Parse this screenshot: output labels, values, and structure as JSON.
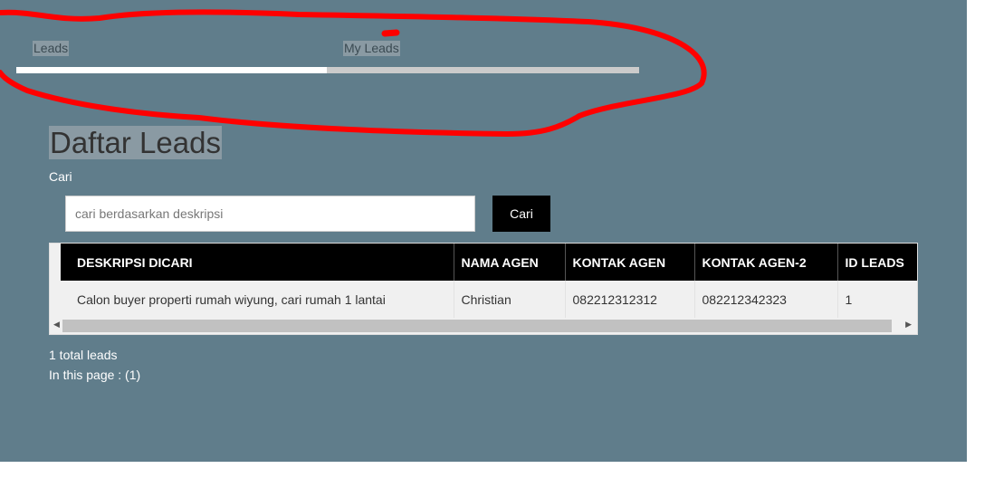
{
  "tabs": [
    {
      "label": "Leads",
      "active": true
    },
    {
      "label": "My Leads",
      "active": false
    }
  ],
  "title": "Daftar Leads",
  "search": {
    "label": "Cari",
    "placeholder": "cari berdasarkan deskripsi",
    "button": "Cari"
  },
  "table": {
    "headers": [
      "DESKRIPSI DICARI",
      "NAMA AGEN",
      "KONTAK AGEN",
      "KONTAK AGEN-2",
      "ID LEADS"
    ],
    "rows": [
      [
        "Calon buyer properti rumah wiyung, cari rumah 1 lantai",
        "Christian",
        "082212312312",
        "082212342323",
        "1"
      ]
    ]
  },
  "footer": {
    "total": "1 total leads",
    "page": "In this page : (1)"
  },
  "colors": {
    "background": "#607d8b",
    "annotation": "#ff0000"
  }
}
